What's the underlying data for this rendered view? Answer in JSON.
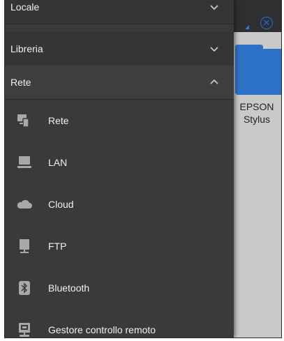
{
  "background": {
    "folder_label": "EPSON Stylus",
    "close_icon": "close-circle-icon"
  },
  "drawer": {
    "sections": [
      {
        "label": "Locale",
        "expanded": false,
        "icon": "chevron-down-icon"
      },
      {
        "label": "Libreria",
        "expanded": false,
        "icon": "chevron-down-icon"
      },
      {
        "label": "Rete",
        "expanded": true,
        "icon": "chevron-up-icon"
      }
    ],
    "items": [
      {
        "label": "Rete",
        "icon": "network-devices-icon"
      },
      {
        "label": "LAN",
        "icon": "computer-icon"
      },
      {
        "label": "Cloud",
        "icon": "cloud-icon"
      },
      {
        "label": "FTP",
        "icon": "ftp-server-icon"
      },
      {
        "label": "Bluetooth",
        "icon": "bluetooth-icon"
      },
      {
        "label": "Gestore controllo remoto",
        "icon": "remote-control-icon"
      }
    ]
  },
  "colors": {
    "drawer_bg": "#3a3a3c",
    "section_bg": "#353537",
    "accent_blue": "#1f6fd6",
    "icon_gray": "#a8a8ab"
  }
}
